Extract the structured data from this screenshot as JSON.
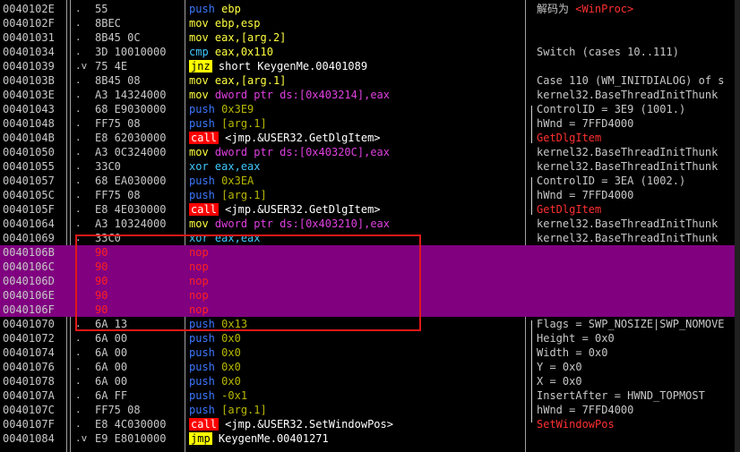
{
  "disassembly": {
    "rows": [
      {
        "addr": "0040102E",
        "flow": ".",
        "hex": "55",
        "mnemonic": "push",
        "operand": "ebp",
        "comment": "解码为 ",
        "comment_tag": "<WinProc>",
        "mn_class": "push",
        "op_class": "reg"
      },
      {
        "addr": "0040102F",
        "flow": ".",
        "hex": "8BEC",
        "mnemonic": "mov",
        "operand": "ebp,esp",
        "comment": "",
        "mn_class": "mov",
        "op_class": "reg"
      },
      {
        "addr": "00401031",
        "flow": ".",
        "hex": "8B45 0C",
        "mnemonic": "mov",
        "operand": "eax,[arg.2]",
        "comment": "",
        "mn_class": "mov",
        "op_class": "reg"
      },
      {
        "addr": "00401034",
        "flow": ".",
        "hex": "3D 10010000",
        "mnemonic": "cmp",
        "operand": "eax,0x110",
        "comment": "Switch (cases 10..111)",
        "mn_class": "cmp",
        "op_class": "reg"
      },
      {
        "addr": "00401039",
        "flow": ".v",
        "hex": "75 4E",
        "mnemonic": "jnz",
        "operand": "short KeygenMe.00401089",
        "comment": "",
        "mn_class": "jmp",
        "op_class": "txt"
      },
      {
        "addr": "0040103B",
        "flow": ".",
        "hex": "8B45 08",
        "mnemonic": "mov",
        "operand": "eax,[arg.1]",
        "comment": "Case 110 (WM_INITDIALOG) of s",
        "mn_class": "mov",
        "op_class": "reg"
      },
      {
        "addr": "0040103E",
        "flow": ".",
        "hex": "A3 14324000",
        "mnemonic": "mov",
        "operand": "dword ptr ds:[0x403214],eax",
        "comment": "kernel32.BaseThreadInitThunk",
        "mn_class": "mov",
        "op_class": "mem"
      },
      {
        "addr": "00401043",
        "flow": ".",
        "hex": "68 E9030000",
        "mnemonic": "push",
        "operand": "0x3E9",
        "comment": "ControlID = 3E9 (1001.)",
        "mn_class": "push",
        "op_class": "imm"
      },
      {
        "addr": "00401048",
        "flow": ".",
        "hex": "FF75 08",
        "mnemonic": "push",
        "operand": "[arg.1]",
        "comment": "hWnd = 7FFD4000",
        "mn_class": "push",
        "op_class": "imm"
      },
      {
        "addr": "0040104B",
        "flow": ".",
        "hex": "E8 62030000",
        "mnemonic": "call",
        "operand": "<jmp.&USER32.GetDlgItem>",
        "comment": "GetDlgItem",
        "comment_is_api": true,
        "mn_class": "call",
        "op_class": "txt"
      },
      {
        "addr": "00401050",
        "flow": ".",
        "hex": "A3 0C324000",
        "mnemonic": "mov",
        "operand": "dword ptr ds:[0x40320C],eax",
        "comment": "kernel32.BaseThreadInitThunk",
        "mn_class": "mov",
        "op_class": "mem"
      },
      {
        "addr": "00401055",
        "flow": ".",
        "hex": "33C0",
        "mnemonic": "xor",
        "operand": "eax,eax",
        "comment": "kernel32.BaseThreadInitThunk",
        "mn_class": "xor",
        "op_class": "xreg"
      },
      {
        "addr": "00401057",
        "flow": ".",
        "hex": "68 EA030000",
        "mnemonic": "push",
        "operand": "0x3EA",
        "comment": "ControlID = 3EA (1002.)",
        "mn_class": "push",
        "op_class": "imm"
      },
      {
        "addr": "0040105C",
        "flow": ".",
        "hex": "FF75 08",
        "mnemonic": "push",
        "operand": "[arg.1]",
        "comment": "hWnd = 7FFD4000",
        "mn_class": "push",
        "op_class": "imm"
      },
      {
        "addr": "0040105F",
        "flow": ".",
        "hex": "E8 4E030000",
        "mnemonic": "call",
        "operand": "<jmp.&USER32.GetDlgItem>",
        "comment": "GetDlgItem",
        "comment_is_api": true,
        "mn_class": "call",
        "op_class": "txt"
      },
      {
        "addr": "00401064",
        "flow": ".",
        "hex": "A3 10324000",
        "mnemonic": "mov",
        "operand": "dword ptr ds:[0x403210],eax",
        "comment": "kernel32.BaseThreadInitThunk",
        "mn_class": "mov",
        "op_class": "mem"
      },
      {
        "addr": "00401069",
        "flow": ".",
        "hex": "33C0",
        "mnemonic": "xor",
        "operand": "eax,eax",
        "comment": "kernel32.BaseThreadInitThunk",
        "mn_class": "xor",
        "op_class": "xreg"
      },
      {
        "addr": "0040106B",
        "flow": "",
        "hex": "90",
        "mnemonic": "nop",
        "operand": "",
        "comment": "",
        "mn_class": "nop",
        "op_class": "",
        "highlight": true
      },
      {
        "addr": "0040106C",
        "flow": "",
        "hex": "90",
        "mnemonic": "nop",
        "operand": "",
        "comment": "",
        "mn_class": "nop",
        "op_class": "",
        "highlight": true
      },
      {
        "addr": "0040106D",
        "flow": "",
        "hex": "90",
        "mnemonic": "nop",
        "operand": "",
        "comment": "",
        "mn_class": "nop",
        "op_class": "",
        "highlight": true
      },
      {
        "addr": "0040106E",
        "flow": "",
        "hex": "90",
        "mnemonic": "nop",
        "operand": "",
        "comment": "",
        "mn_class": "nop",
        "op_class": "",
        "highlight": true
      },
      {
        "addr": "0040106F",
        "flow": "",
        "hex": "90",
        "mnemonic": "nop",
        "operand": "",
        "comment": "",
        "mn_class": "nop",
        "op_class": "",
        "highlight": true
      },
      {
        "addr": "00401070",
        "flow": ".",
        "hex": "6A 13",
        "mnemonic": "push",
        "operand": "0x13",
        "comment": "Flags = SWP_NOSIZE|SWP_NOMOVE",
        "mn_class": "push",
        "op_class": "imm"
      },
      {
        "addr": "00401072",
        "flow": ".",
        "hex": "6A 00",
        "mnemonic": "push",
        "operand": "0x0",
        "comment": "Height = 0x0",
        "mn_class": "push",
        "op_class": "imm"
      },
      {
        "addr": "00401074",
        "flow": ".",
        "hex": "6A 00",
        "mnemonic": "push",
        "operand": "0x0",
        "comment": "Width = 0x0",
        "mn_class": "push",
        "op_class": "imm"
      },
      {
        "addr": "00401076",
        "flow": ".",
        "hex": "6A 00",
        "mnemonic": "push",
        "operand": "0x0",
        "comment": "Y = 0x0",
        "mn_class": "push",
        "op_class": "imm"
      },
      {
        "addr": "00401078",
        "flow": ".",
        "hex": "6A 00",
        "mnemonic": "push",
        "operand": "0x0",
        "comment": "X = 0x0",
        "mn_class": "push",
        "op_class": "imm"
      },
      {
        "addr": "0040107A",
        "flow": ".",
        "hex": "6A FF",
        "mnemonic": "push",
        "operand": "-0x1",
        "comment": "InsertAfter = HWND_TOPMOST",
        "mn_class": "push",
        "op_class": "imm"
      },
      {
        "addr": "0040107C",
        "flow": ".",
        "hex": "FF75 08",
        "mnemonic": "push",
        "operand": "[arg.1]",
        "comment": "hWnd = 7FFD4000",
        "mn_class": "push",
        "op_class": "imm"
      },
      {
        "addr": "0040107F",
        "flow": ".",
        "hex": "E8 4C030000",
        "mnemonic": "call",
        "operand": "<jmp.&USER32.SetWindowPos>",
        "comment": "SetWindowPos",
        "comment_is_api": true,
        "mn_class": "call",
        "op_class": "txt"
      },
      {
        "addr": "00401084",
        "flow": ".v",
        "hex": "E9 E8010000",
        "mnemonic": "jmp",
        "operand": "KeygenMe.00401271",
        "comment": "",
        "mn_class": "jmp",
        "op_class": "txt"
      }
    ]
  }
}
